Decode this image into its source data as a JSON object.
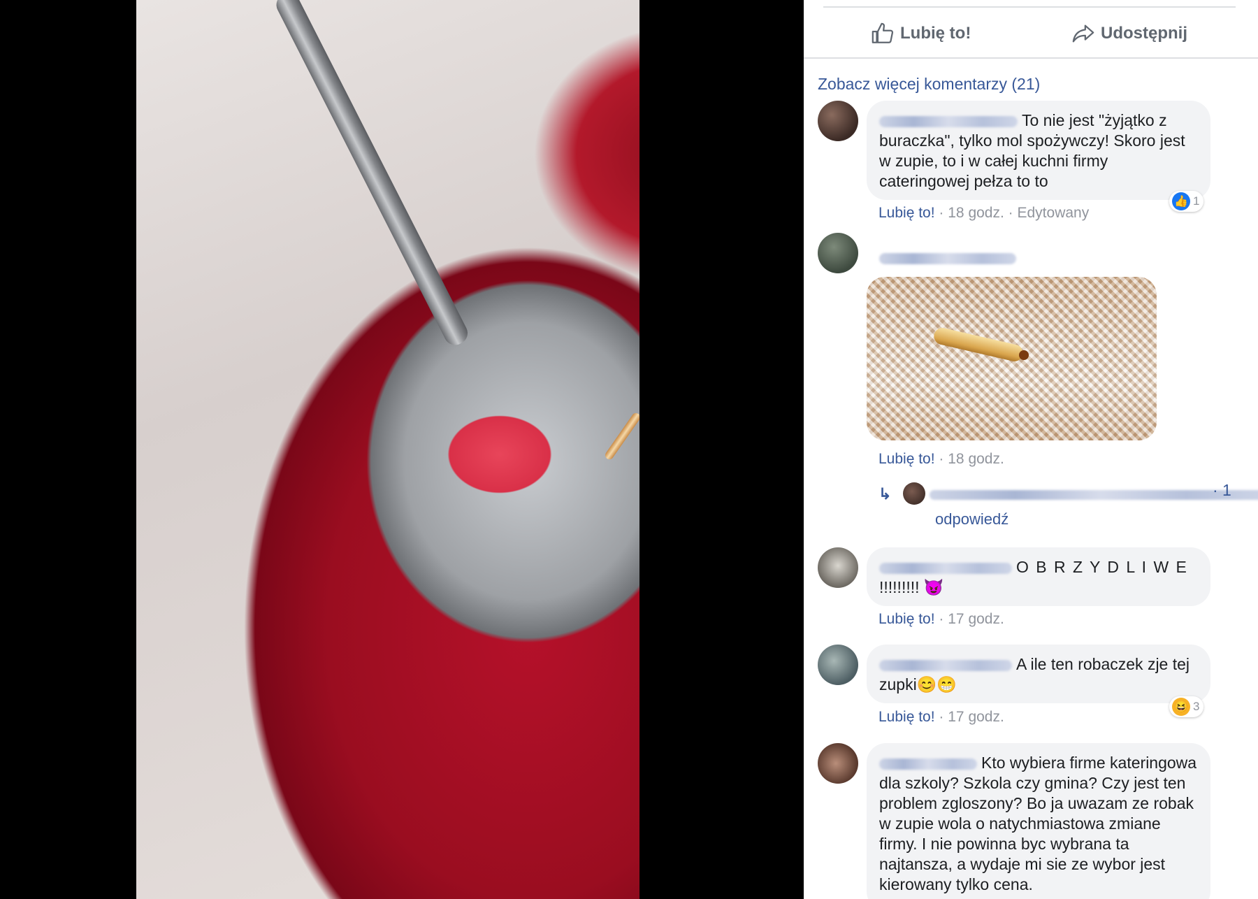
{
  "actions": {
    "like_label": "Lubię to!",
    "share_label": "Udostępnij"
  },
  "more_comments": "Zobacz więcej komentarzy (21)",
  "comments": [
    {
      "text": "To nie jest \"żyjątko z buraczka\", tylko mol spożywczy! Skoro jest w zupie, to i w całej kuchni firmy cateringowej pełza to to",
      "like": "Lubię to!",
      "time": "· 18 godz.",
      "edited": "· Edytowany",
      "reaction_count": "1"
    },
    {
      "like": "Lubię to!",
      "time": "· 18 godz.",
      "reply_arrow": "↳",
      "reply_count": "· 1",
      "reply_link": "odpowiedź"
    },
    {
      "text": "O B R Z Y D L I W E",
      "text2": "!!!!!!!!! 😈",
      "like": "Lubię to!",
      "time": "· 17 godz."
    },
    {
      "text": "A ile ten robaczek zje tej zupki😊😁",
      "like": "Lubię to!",
      "time": "· 17 godz.",
      "reaction_count": "3"
    },
    {
      "text": "Kto wybiera firme kateringowa dla szkoly? Szkola czy gmina? Czy jest ten problem zgloszony? Bo ja uwazam ze robak w zupie wola o natychmiastowa zmiane firmy. I nie powinna byc wybrana ta najtansza, a wydaje mi sie ze wybor jest kierowany tylko cena."
    }
  ],
  "colors": {
    "link": "#385898",
    "bubble": "#f2f3f5",
    "meta": "#90949c"
  }
}
